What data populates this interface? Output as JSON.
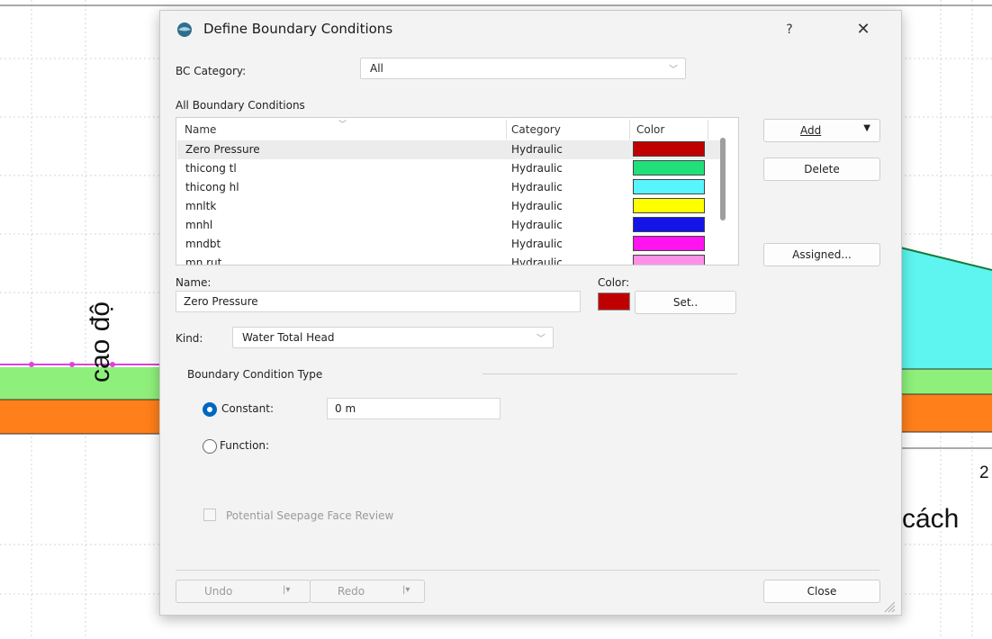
{
  "background": {
    "y_axis_label": "cao độ",
    "x_axis_label": "cách",
    "x_tick": "2"
  },
  "dialog": {
    "title": "Define Boundary Conditions",
    "help_label": "?",
    "close_icon_label": "✕",
    "bc_category_label": "BC Category:",
    "bc_category_value": "All",
    "all_bc_label": "All Boundary Conditions",
    "list": {
      "headers": {
        "name": "Name",
        "category": "Category",
        "color": "Color"
      },
      "rows": [
        {
          "name": "Zero Pressure",
          "category": "Hydraulic",
          "color": "#c00000"
        },
        {
          "name": "thicong tl",
          "category": "Hydraulic",
          "color": "#21e07a"
        },
        {
          "name": "thicong hl",
          "category": "Hydraulic",
          "color": "#58f4ff"
        },
        {
          "name": "mnltk",
          "category": "Hydraulic",
          "color": "#ffff00"
        },
        {
          "name": "mnhl",
          "category": "Hydraulic",
          "color": "#1414e8"
        },
        {
          "name": "mndbt",
          "category": "Hydraulic",
          "color": "#ff14f0"
        },
        {
          "name": "mn rut",
          "category": "Hydraulic",
          "color": "#ff90e8"
        }
      ]
    },
    "buttons": {
      "add": "Add",
      "delete": "Delete",
      "assigned": "Assigned...",
      "set": "Set..",
      "undo": "Undo",
      "redo": "Redo",
      "close": "Close"
    },
    "name_label": "Name:",
    "name_value": "Zero Pressure",
    "color_label": "Color:",
    "selected_color": "#c00000",
    "kind_label": "Kind:",
    "kind_value": "Water Total Head",
    "bct_label": "Boundary Condition Type",
    "constant_label": "Constant:",
    "constant_value": "0 m",
    "function_label": "Function:",
    "seepage_label": "Potential Seepage Face Review",
    "accent_color": "#0067c0"
  }
}
